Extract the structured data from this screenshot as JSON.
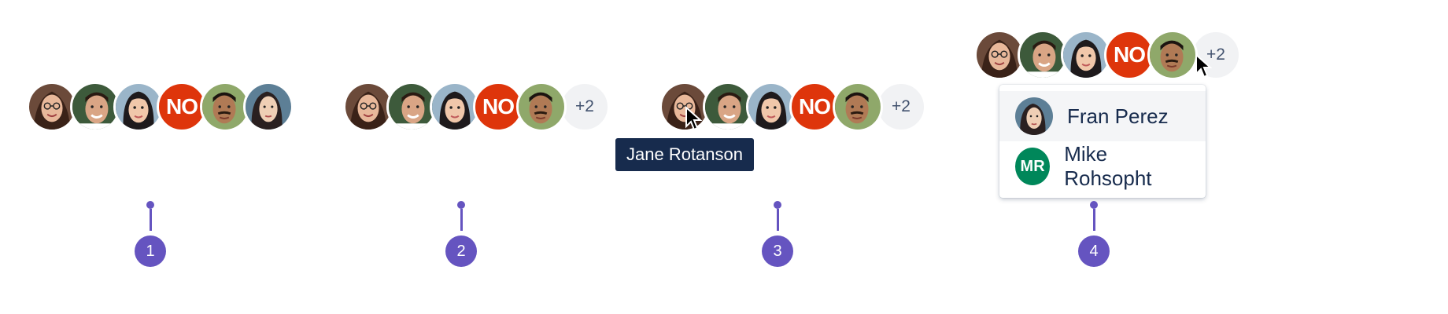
{
  "colors": {
    "accent": "#6554c0",
    "tooltip_bg": "#172b4d",
    "no_avatar": "#de350b",
    "mr_avatar": "#00875a",
    "more_bg": "#f1f2f4"
  },
  "groups": [
    {
      "avatars": [
        {
          "kind": "photo",
          "icon": "woman-glasses-avatar"
        },
        {
          "kind": "photo",
          "icon": "man-smiling-avatar"
        },
        {
          "kind": "photo",
          "icon": "woman-dark-hair-avatar"
        },
        {
          "kind": "initials",
          "initials": "NO"
        },
        {
          "kind": "photo",
          "icon": "man-mustache-avatar"
        },
        {
          "kind": "photo",
          "icon": "woman-profile-avatar"
        }
      ]
    },
    {
      "avatars": [
        {
          "kind": "photo",
          "icon": "woman-glasses-avatar"
        },
        {
          "kind": "photo",
          "icon": "man-smiling-avatar"
        },
        {
          "kind": "photo",
          "icon": "woman-dark-hair-avatar"
        },
        {
          "kind": "initials",
          "initials": "NO"
        },
        {
          "kind": "photo",
          "icon": "man-mustache-avatar"
        }
      ],
      "more_label": "+2"
    },
    {
      "avatars": [
        {
          "kind": "photo",
          "icon": "woman-glasses-avatar"
        },
        {
          "kind": "photo",
          "icon": "man-smiling-avatar"
        },
        {
          "kind": "photo",
          "icon": "woman-dark-hair-avatar"
        },
        {
          "kind": "initials",
          "initials": "NO"
        },
        {
          "kind": "photo",
          "icon": "man-mustache-avatar"
        }
      ],
      "more_label": "+2",
      "tooltip": "Jane Rotanson"
    },
    {
      "avatars": [
        {
          "kind": "photo",
          "icon": "woman-glasses-avatar"
        },
        {
          "kind": "photo",
          "icon": "man-smiling-avatar"
        },
        {
          "kind": "photo",
          "icon": "woman-dark-hair-avatar"
        },
        {
          "kind": "initials",
          "initials": "NO"
        },
        {
          "kind": "photo",
          "icon": "man-mustache-avatar"
        }
      ],
      "more_label": "+2",
      "dropdown": [
        {
          "name": "Fran Perez",
          "avatar": "woman-profile-avatar"
        },
        {
          "name": "Mike Rohsopht",
          "initials": "MR"
        }
      ]
    }
  ],
  "markers": [
    "1",
    "2",
    "3",
    "4"
  ]
}
